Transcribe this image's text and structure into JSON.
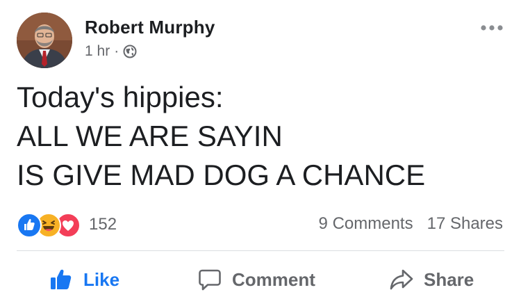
{
  "post": {
    "author": "Robert Murphy",
    "time": "1 hr",
    "separator": "·",
    "audience_icon": "globe-icon",
    "menu_icon": "more-options-icon",
    "text": "Today's hippies:\nALL WE ARE SAYIN\nIS GIVE MAD DOG A CHANCE"
  },
  "stats": {
    "reaction_icons": [
      "like-reaction-icon",
      "haha-reaction-icon",
      "love-reaction-icon"
    ],
    "reaction_count": "152",
    "comments": "9 Comments",
    "shares": "17 Shares"
  },
  "actions": {
    "like": "Like",
    "comment": "Comment",
    "share": "Share"
  },
  "colors": {
    "facebook_blue": "#1877f2",
    "secondary_text": "#65676b",
    "primary_text": "#1c1e21",
    "haha_yellow": "#f7b125",
    "love_red": "#f33e58",
    "divider": "#dadde1"
  }
}
